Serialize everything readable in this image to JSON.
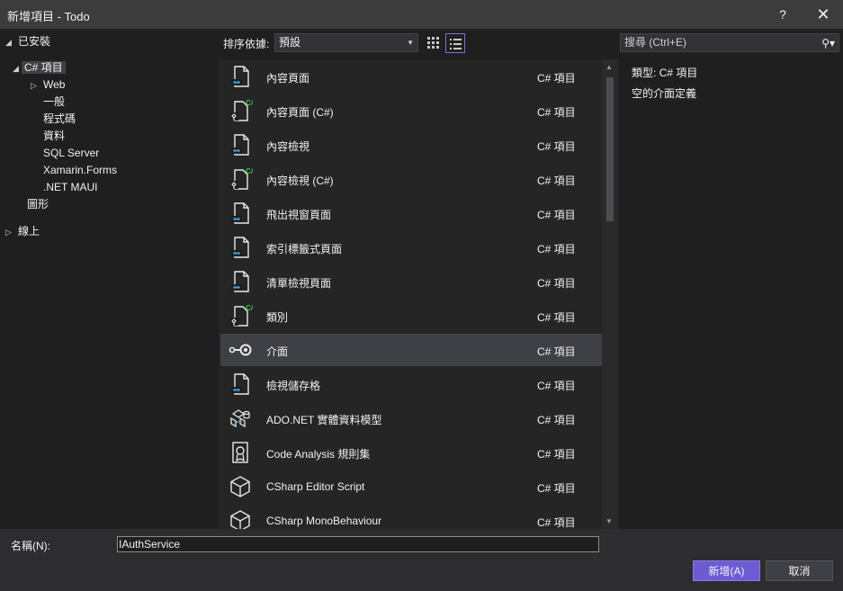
{
  "window": {
    "title": "新增項目 - Todo",
    "help": "?",
    "close": "✕"
  },
  "tree": {
    "installed": "已安裝",
    "csharp": "C# 項目",
    "web": "Web",
    "general": "一般",
    "code": "程式碼",
    "data": "資料",
    "sqlserver": "SQL Server",
    "xamarin": "Xamarin.Forms",
    "maui": ".NET MAUI",
    "graphics": "圖形",
    "online": "線上"
  },
  "toolbar": {
    "sort_label": "排序依據:",
    "sort_value": "預設"
  },
  "search": {
    "placeholder": "搜尋 (Ctrl+E)"
  },
  "items": [
    {
      "name": "內容頁面",
      "type": "C# 項目",
      "icon": "xaml-page-icon"
    },
    {
      "name": "內容頁面 (C#)",
      "type": "C# 項目",
      "icon": "csharp-page-icon"
    },
    {
      "name": "內容檢視",
      "type": "C# 項目",
      "icon": "xaml-page-icon"
    },
    {
      "name": "內容檢視 (C#)",
      "type": "C# 項目",
      "icon": "csharp-page-icon"
    },
    {
      "name": "飛出視窗頁面",
      "type": "C# 項目",
      "icon": "xaml-page-icon"
    },
    {
      "name": "索引標籤式頁面",
      "type": "C# 項目",
      "icon": "xaml-page-icon"
    },
    {
      "name": "清單檢視頁面",
      "type": "C# 項目",
      "icon": "xaml-page-icon"
    },
    {
      "name": "類別",
      "type": "C# 項目",
      "icon": "csharp-class-icon"
    },
    {
      "name": "介面",
      "type": "C# 項目",
      "icon": "interface-icon"
    },
    {
      "name": "檢視儲存格",
      "type": "C# 項目",
      "icon": "xaml-page-icon"
    },
    {
      "name": "ADO.NET 實體資料模型",
      "type": "C# 項目",
      "icon": "entity-model-icon"
    },
    {
      "name": "Code Analysis 規則集",
      "type": "C# 項目",
      "icon": "ruleset-icon"
    },
    {
      "name": "CSharp Editor Script",
      "type": "C# 項目",
      "icon": "cube-icon"
    },
    {
      "name": "CSharp MonoBehaviour",
      "type": "C# 項目",
      "icon": "cube-icon"
    }
  ],
  "detail": {
    "type_label": "類型:",
    "type_value": "C# 項目",
    "description": "空的介面定義"
  },
  "bottom": {
    "name_label": "名稱(N):",
    "name_value": "IAuthService",
    "add": "新增(A)",
    "cancel": "取消"
  },
  "colors": {
    "accent": "#6c5bd2",
    "background": "#1f1f1f",
    "list_bg": "#252526",
    "selection": "#3f3f46"
  }
}
